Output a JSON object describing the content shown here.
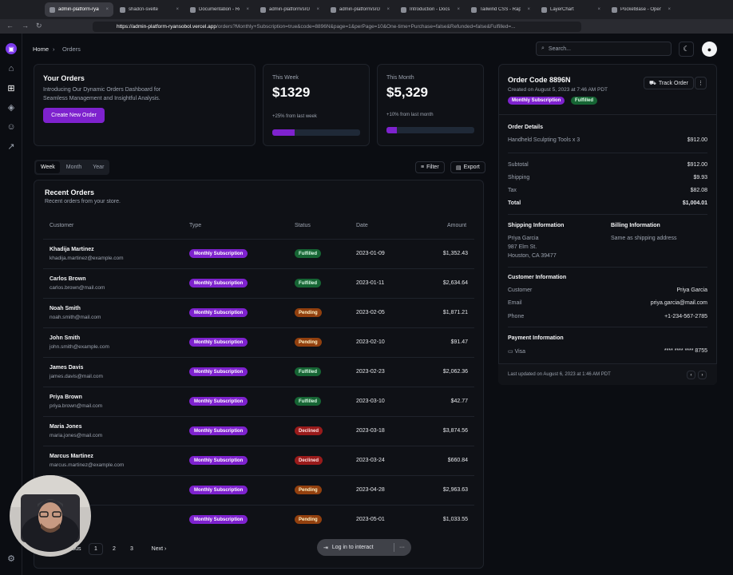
{
  "browser": {
    "tabs": [
      {
        "label": "admin-platform-ryan",
        "active": true
      },
      {
        "label": "shadcn-svelte",
        "active": false
      },
      {
        "label": "Documentation - Remeda",
        "active": false
      },
      {
        "label": "admin-platform/src/...",
        "active": false
      },
      {
        "label": "admin-platform/src/...",
        "active": false
      },
      {
        "label": "Introduction - Docs",
        "active": false
      },
      {
        "label": "Tailwind CSS - Rapid",
        "active": false
      },
      {
        "label": "LayerChart",
        "active": false
      },
      {
        "label": "PocketBase - Open S",
        "active": false
      }
    ],
    "url_host": "https://admin-platform-ryansobol.vercel.app",
    "url_path": "/orders?Monthly+Subscription=true&code=8896N&page=1&perPage=10&One-time+Purchase=false&Refunded=false&Fulfilled=..."
  },
  "breadcrumb": {
    "home": "Home",
    "sep": "›",
    "current": "Orders"
  },
  "search": {
    "placeholder": "Search..."
  },
  "welcome": {
    "title": "Your Orders",
    "description": "Introducing Our Dynamic Orders Dashboard for Seamless Management and Insightful Analysis.",
    "button": "Create New Order"
  },
  "stats": [
    {
      "label": "This Week",
      "value": "$1329",
      "change": "+25% from last week",
      "progress": 25
    },
    {
      "label": "This Month",
      "value": "$5,329",
      "change": "+10% from last month",
      "progress": 12
    }
  ],
  "period_tabs": [
    "Week",
    "Month",
    "Year"
  ],
  "toolbar": {
    "filter": "Filter",
    "export": "Export"
  },
  "orders_card": {
    "title": "Recent Orders",
    "subtitle": "Recent orders from your store.",
    "columns": [
      "Customer",
      "Type",
      "Status",
      "Date",
      "Amount"
    ],
    "rows": [
      {
        "name": "Khadija Martinez",
        "email": "khadija.martinez@example.com",
        "type": "Monthly Subscription",
        "status": "Fulfilled",
        "date": "2023-01-09",
        "amount": "$1,352.43"
      },
      {
        "name": "Carlos Brown",
        "email": "carlos.brown@mail.com",
        "type": "Monthly Subscription",
        "status": "Fulfilled",
        "date": "2023-01-11",
        "amount": "$2,634.64"
      },
      {
        "name": "Noah Smith",
        "email": "noah.smith@mail.com",
        "type": "Monthly Subscription",
        "status": "Pending",
        "date": "2023-02-05",
        "amount": "$1,871.21"
      },
      {
        "name": "John Smith",
        "email": "john.smith@example.com",
        "type": "Monthly Subscription",
        "status": "Pending",
        "date": "2023-02-10",
        "amount": "$91.47"
      },
      {
        "name": "James Davis",
        "email": "james.davis@mail.com",
        "type": "Monthly Subscription",
        "status": "Fulfilled",
        "date": "2023-02-23",
        "amount": "$2,062.36"
      },
      {
        "name": "Priya Brown",
        "email": "priya.brown@mail.com",
        "type": "Monthly Subscription",
        "status": "Fulfilled",
        "date": "2023-03-10",
        "amount": "$42.77"
      },
      {
        "name": "Maria Jones",
        "email": "maria.jones@mail.com",
        "type": "Monthly Subscription",
        "status": "Declined",
        "date": "2023-03-18",
        "amount": "$3,874.56"
      },
      {
        "name": "Marcus Martinez",
        "email": "marcus.martinez@example.com",
        "type": "Monthly Subscription",
        "status": "Declined",
        "date": "2023-03-24",
        "amount": "$660.84"
      },
      {
        "name": "...vis",
        "email": "...mail.com",
        "type": "Monthly Subscription",
        "status": "Pending",
        "date": "2023-04-28",
        "amount": "$2,963.63"
      },
      {
        "name": "",
        "email": "...@mail.com",
        "type": "Monthly Subscription",
        "status": "Pending",
        "date": "2023-05-01",
        "amount": "$1,033.55"
      }
    ],
    "pagination": {
      "prev": "...ous",
      "pages": [
        "1",
        "2",
        "3"
      ],
      "next": "Next ›"
    }
  },
  "order_detail": {
    "code": "Order Code 8896N",
    "created": "Created on August 5, 2023 at 7:46 AM PDT",
    "badges": [
      "Monthly Subscription",
      "Fulfilled"
    ],
    "track_button": "Track Order",
    "details_heading": "Order Details",
    "line_item": "Handheld Sculpting Tools x 3",
    "line_item_price": "$912.00",
    "subtotal_label": "Subtotal",
    "subtotal": "$912.00",
    "shipping_label": "Shipping",
    "shipping": "$9.93",
    "tax_label": "Tax",
    "tax": "$82.08",
    "total_label": "Total",
    "total": "$1,004.01",
    "shipping_heading": "Shipping Information",
    "ship_name": "Priya Garcia",
    "ship_street": "987 Elm St.",
    "ship_city": "Houston, CA 39477",
    "billing_heading": "Billing Information",
    "billing_text": "Same as shipping address",
    "customer_heading": "Customer Information",
    "customer_label": "Customer",
    "customer": "Priya Garcia",
    "email_label": "Email",
    "email": "priya.garcia@mail.com",
    "phone_label": "Phone",
    "phone": "+1-234-567-2785",
    "payment_heading": "Payment Information",
    "payment_method": "Visa",
    "card_number": "**** **** **** 8755",
    "updated": "Last updated on August 6, 2023 at 1:46 AM PDT"
  },
  "toast": {
    "label": "Log in to interact",
    "more": "···"
  }
}
